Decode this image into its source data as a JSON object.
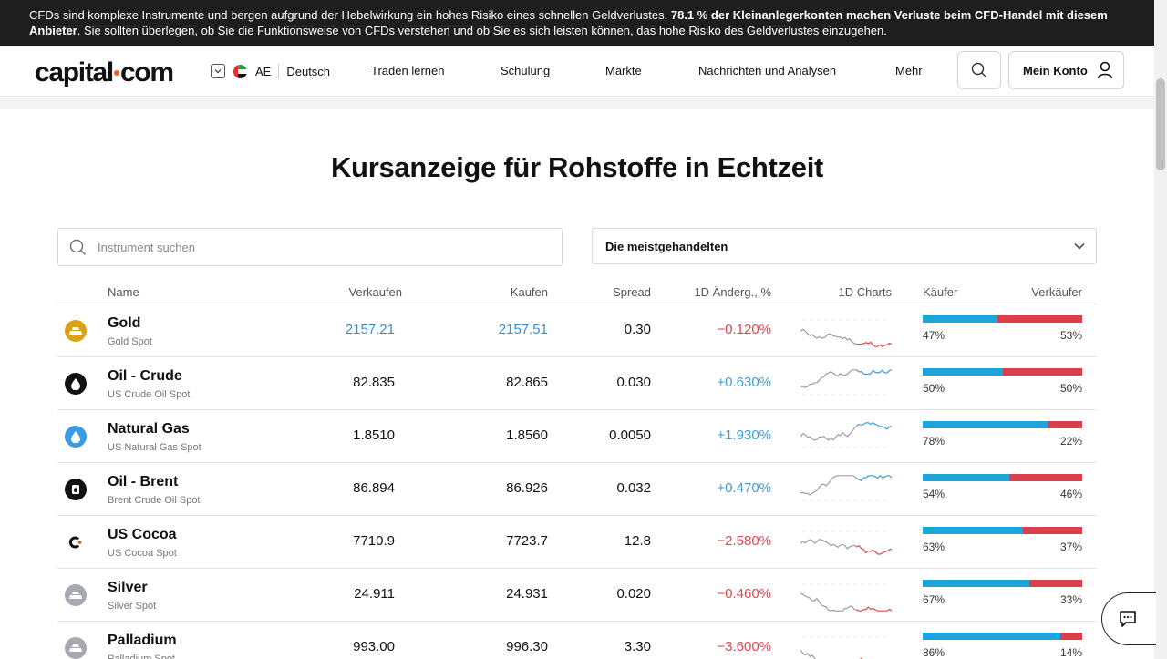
{
  "risk_banner": {
    "text_1": "CFDs sind komplexe Instrumente und bergen aufgrund der Hebelwirkung ein hohes Risiko eines schnellen Geldverlustes.",
    "text_bold": "78.1 % der Kleinanlegerkonten machen Verluste beim CFD-Handel mit diesem Anbieter",
    "text_2": ". Sie sollten überlegen, ob Sie die Funktionsweise von CFDs verstehen und ob Sie es sich leisten können, das hohe Risiko des Geldverlustes einzugehen."
  },
  "header": {
    "logo_left": "capital",
    "logo_right": "com",
    "region_code": "AE",
    "language": "Deutsch",
    "nav": [
      "Traden lernen",
      "Schulung",
      "Märkte",
      "Nachrichten und Analysen",
      "Mehr"
    ],
    "account_label": "Mein Konto"
  },
  "page_title": "Kursanzeige für Rohstoffe in Echtzeit",
  "search": {
    "placeholder": "Instrument suchen"
  },
  "filter": {
    "selected": "Die meistgehandelten"
  },
  "table": {
    "headers": {
      "name": "Name",
      "sell": "Verkaufen",
      "buy": "Kaufen",
      "spread": "Spread",
      "change": "1D Änderg., %",
      "charts": "1D Charts",
      "buyers": "Käufer",
      "sellers": "Verkäufer"
    },
    "rows": [
      {
        "name": "Gold",
        "sub": "Gold Spot",
        "sell": "2157.21",
        "buy": "2157.51",
        "spread": "0.30",
        "change": "-0.120%",
        "buyers_pct": "47%",
        "sellers_pct": "53%",
        "buyers": 47
      },
      {
        "name": "Oil - Crude",
        "sub": "US Crude Oil Spot",
        "sell": "82.835",
        "buy": "82.865",
        "spread": "0.030",
        "change": "+0.630%",
        "buyers_pct": "50%",
        "sellers_pct": "50%",
        "buyers": 50
      },
      {
        "name": "Natural Gas",
        "sub": "US Natural Gas Spot",
        "sell": "1.8510",
        "buy": "1.8560",
        "spread": "0.0050",
        "change": "+1.930%",
        "buyers_pct": "78%",
        "sellers_pct": "22%",
        "buyers": 78
      },
      {
        "name": "Oil - Brent",
        "sub": "Brent Crude Oil Spot",
        "sell": "86.894",
        "buy": "86.926",
        "spread": "0.032",
        "change": "+0.470%",
        "buyers_pct": "54%",
        "sellers_pct": "46%",
        "buyers": 54
      },
      {
        "name": "US Cocoa",
        "sub": "US Cocoa Spot",
        "sell": "7710.9",
        "buy": "7723.7",
        "spread": "12.8",
        "change": "-2.580%",
        "buyers_pct": "63%",
        "sellers_pct": "37%",
        "buyers": 63
      },
      {
        "name": "Silver",
        "sub": "Silver Spot",
        "sell": "24.911",
        "buy": "24.931",
        "spread": "0.020",
        "change": "-0.460%",
        "buyers_pct": "67%",
        "sellers_pct": "33%",
        "buyers": 67
      },
      {
        "name": "Palladium",
        "sub": "Palladium Spot",
        "sell": "993.00",
        "buy": "996.30",
        "spread": "3.30",
        "change": "-3.600%",
        "buyers_pct": "86%",
        "sellers_pct": "14%",
        "buyers": 86
      }
    ]
  },
  "colors": {
    "positive": "#3aa0d4",
    "negative": "#e0454f",
    "buyers_bar": "#1ea4d8",
    "sellers_bar": "#d9404c",
    "link": "#3b8fd1"
  },
  "icons": [
    "search-icon",
    "user-icon",
    "chevron-down-icon",
    "chat-icon",
    "gold-icon",
    "oil-drop-icon",
    "gas-drop-icon",
    "brent-icon",
    "cocoa-icon",
    "silver-icon",
    "palladium-icon"
  ]
}
